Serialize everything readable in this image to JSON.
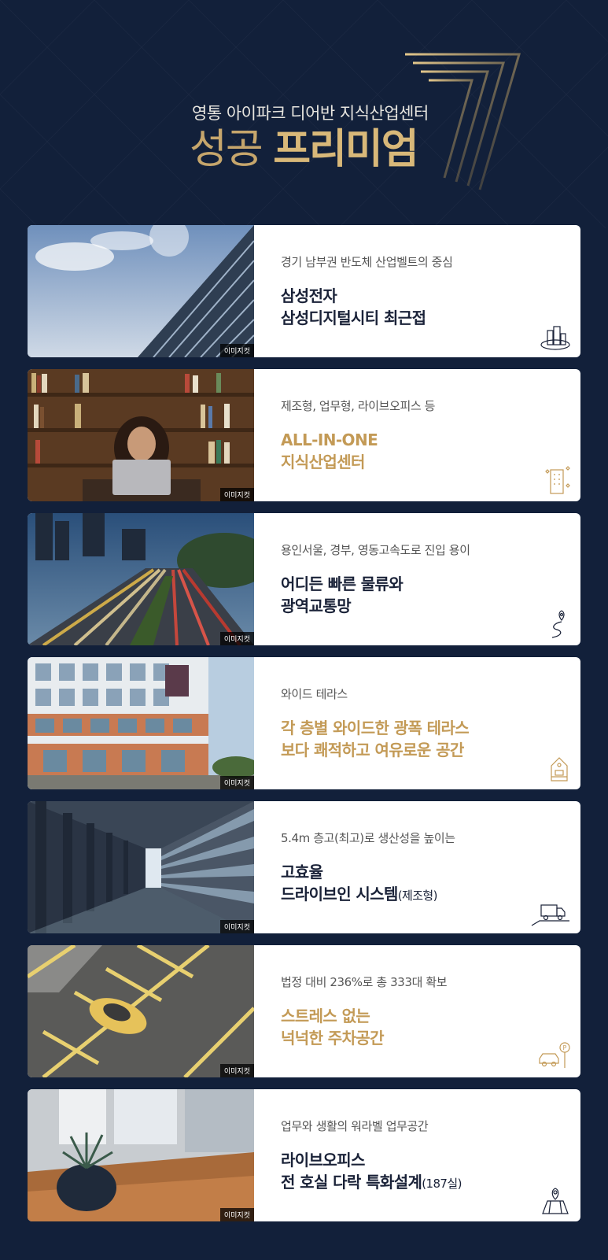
{
  "header": {
    "subtitle": "영통 아이파크 디어반 지식산업센터",
    "title_part1": "성공",
    "title_part2": "프리미엄",
    "emblem_number": "7"
  },
  "image_tag": "이미지컷",
  "cards": [
    {
      "desc": "경기 남부권 반도체 산업벨트의 중심",
      "line1": "삼성전자",
      "line2": "삼성디지털시티 최근접",
      "line2_suffix": "",
      "style": "navy",
      "icon": "city-buildings-icon",
      "photo": "glass-building-sky-photo"
    },
    {
      "desc": "제조형, 업무형, 라이브오피스 등",
      "line1": "ALL-IN-ONE",
      "line2": "지식산업센터",
      "line2_suffix": "",
      "style": "gold",
      "icon": "office-building-icon",
      "photo": "library-laptop-photo"
    },
    {
      "desc": "용인서울, 경부, 영동고속도로 진입 용이",
      "line1": "어디든 빠른 물류와",
      "line2": "광역교통망",
      "line2_suffix": "",
      "style": "navy",
      "icon": "route-pin-icon",
      "photo": "highway-night-photo"
    },
    {
      "desc": "와이드 테라스",
      "line1": "각 층별 와이드한 광폭 테라스",
      "line2": "보다 쾌적하고 여유로운 공간",
      "line2_suffix": "",
      "style": "gold",
      "icon": "house-icon",
      "photo": "terrace-building-photo"
    },
    {
      "desc": "5.4m 층고(최고)로 생산성을 높이는",
      "line1": "고효율",
      "line2": "드라이브인 시스템",
      "line2_suffix": "(제조형)",
      "style": "navy",
      "icon": "truck-icon",
      "photo": "concrete-corridor-photo"
    },
    {
      "desc": "법정 대비 236%로 총 333대 확보",
      "line1": "스트레스 없는",
      "line2": "넉넉한 주차공간",
      "line2_suffix": "",
      "style": "gold",
      "icon": "car-parking-icon",
      "photo": "parking-lot-car-photo"
    },
    {
      "desc": "업무와 생활의 워라벨 업무공간",
      "line1": "라이브오피스",
      "line2": "전 호실 다락 특화설계",
      "line2_suffix": "(187실)",
      "style": "navy",
      "icon": "map-pin-icon",
      "photo": "office-plant-photo"
    }
  ],
  "colors": {
    "background": "#12203a",
    "gold": "#c39a56",
    "navy_text": "#1a2238"
  }
}
